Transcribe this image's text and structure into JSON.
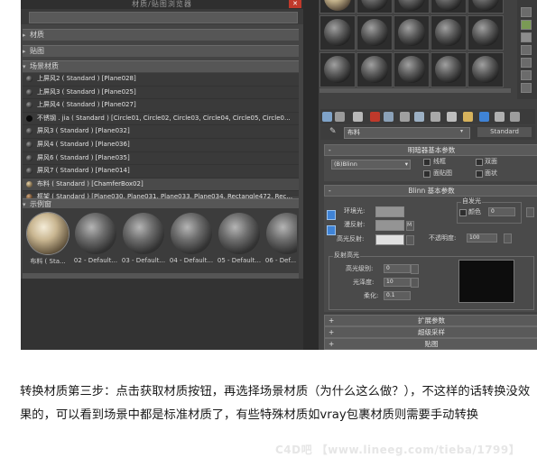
{
  "browser": {
    "title": "材质/贴图浏览器",
    "groups": {
      "materials": "材质",
      "maps": "贴图",
      "scene_materials": "场景材质",
      "sample_slots": "示例窗"
    },
    "scene_materials": [
      "上屏风2 ( Standard ) [Plane028]",
      "上屏风3 ( Standard ) [Plane025]",
      "上屏风4 ( Standard ) [Plane027]",
      "不锈钢 . jia ( Standard ) [Circle01, Circle02, Circle03, Circle04, Circle05, Circle0...",
      "屏风3 ( Standard ) [Plane032]",
      "屏风4 ( Standard ) [Plane036]",
      "屏风6 ( Standard ) [Plane035]",
      "屏风7 ( Standard ) [Plane014]",
      "布料 ( Standard ) [ChamferBox02]",
      "框架 ( Standard ) [Plane030, Plane031, Plane033, Plane034, Rectangle472, Rec..."
    ],
    "samples": [
      "布料 ( Sta...",
      "02 - Default...",
      "03 - Default...",
      "04 - Default...",
      "05 - Default...",
      "06 - Def..."
    ]
  },
  "editor": {
    "material_name": "布料",
    "material_type": "Standard",
    "shader_basic_title": "明暗器基本参数",
    "shader_type": "(B)Blinn",
    "options": [
      "线框",
      "双面",
      "面贴图",
      "面状"
    ],
    "blinn_basic_title": "Blinn 基本参数",
    "self_illum_label": "自发光",
    "color_label": "颜色",
    "color_value": "0",
    "ambient_label": "环境光:",
    "diffuse_label": "漫反射:",
    "specular_label": "高光反射:",
    "m_label": "M",
    "opacity_label": "不透明度:",
    "opacity_value": "100",
    "spec_hl_title": "反射高光",
    "spec_level_label": "高光级别:",
    "spec_level_value": "0",
    "glossiness_label": "光泽度:",
    "glossiness_value": "10",
    "soften_label": "柔化:",
    "soften_value": "0.1",
    "extended_title": "扩展参数",
    "supersampling_title": "超级采样",
    "maps_title": "贴图"
  },
  "caption": "转换材质第三步：点击获取材质按钮，再选择场景材质（为什么这么做？），不这样的话转换没效果的，可以看到场景中都是标准材质了，有些特殊材质如vray包裹材质则需要手动转换",
  "watermark": "C4D吧 【www.lineeg.com/tieba/1799】"
}
